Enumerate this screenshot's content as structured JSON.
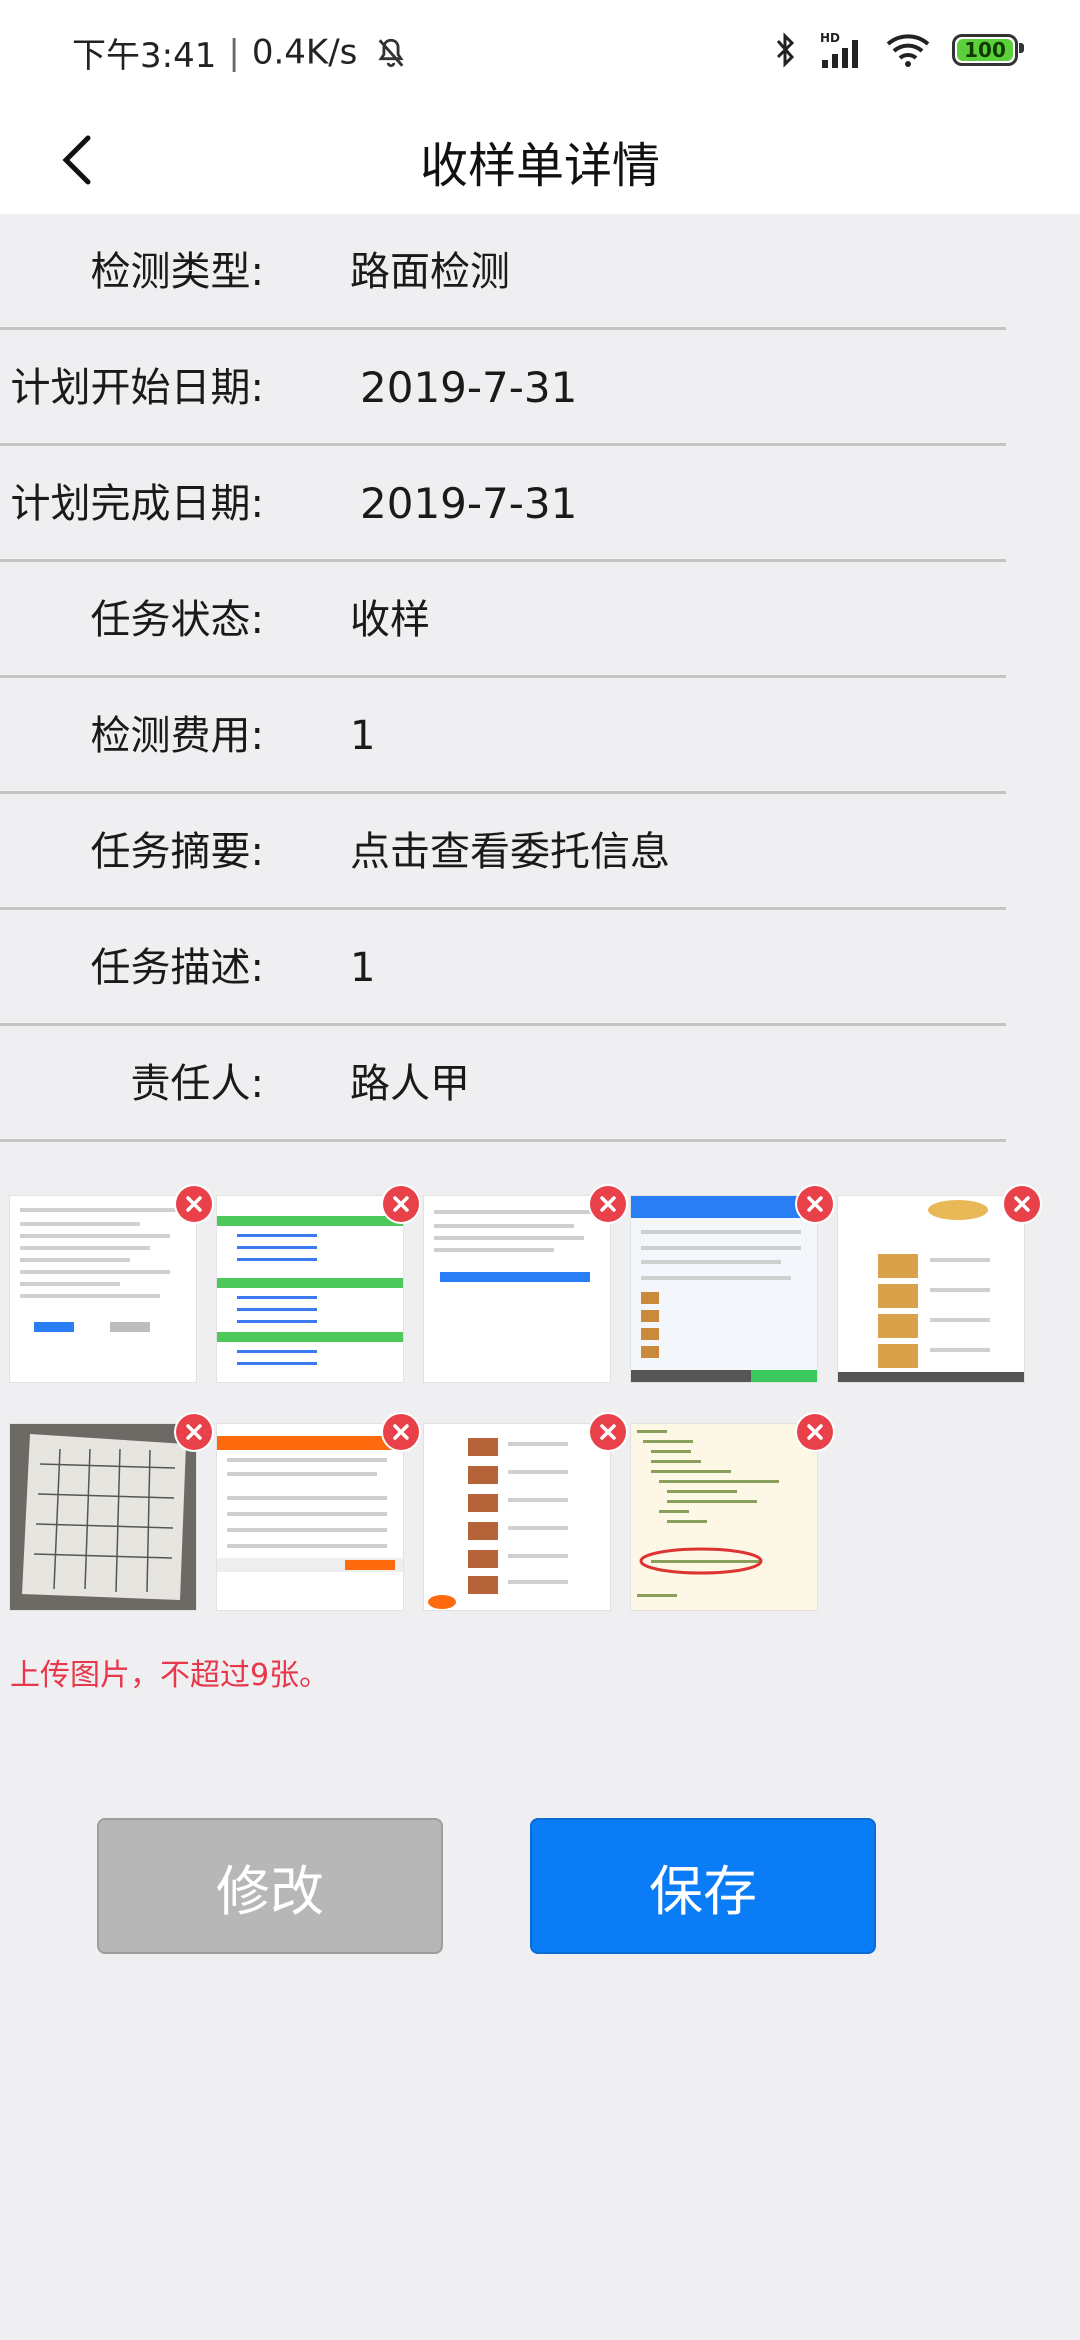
{
  "status_bar": {
    "time": "下午3:41",
    "speed": "0.4K/s",
    "battery": "100",
    "icons": [
      "bluetooth-icon",
      "hd-signal-icon",
      "wifi-icon",
      "battery-icon",
      "bell-off-icon"
    ]
  },
  "header": {
    "title": "收样单详情"
  },
  "fields": [
    {
      "label": "检测类型:",
      "value": "路面检测"
    },
    {
      "label": "计划开始日期:",
      "value": "2019-7-31"
    },
    {
      "label": "计划完成日期:",
      "value": "2019-7-31"
    },
    {
      "label": "任务状态:",
      "value": "收样"
    },
    {
      "label": "检测费用:",
      "value": "1"
    },
    {
      "label": "任务摘要:",
      "value": "点击查看委托信息"
    },
    {
      "label": "任务描述:",
      "value": "1"
    },
    {
      "label": "责任人:",
      "value": "路人甲"
    }
  ],
  "images": {
    "hint": "上传图片，不超过9张。"
  },
  "buttons": {
    "edit": "修改",
    "save": "保存"
  },
  "colors": {
    "primary": "#0a7cf5",
    "disabled": "#b7b7b7",
    "error": "#e8374a",
    "badge": "#e8414a"
  }
}
